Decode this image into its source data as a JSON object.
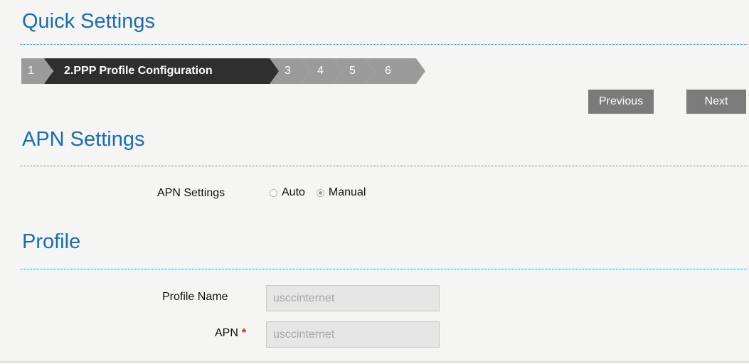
{
  "page": {
    "title": "Quick Settings"
  },
  "wizard": {
    "steps": [
      {
        "label": "1",
        "active": false
      },
      {
        "label": "2.PPP Profile Configuration",
        "active": true
      },
      {
        "label": "3",
        "active": false
      },
      {
        "label": "4",
        "active": false
      },
      {
        "label": "5",
        "active": false
      },
      {
        "label": "6",
        "active": false
      }
    ],
    "previous_label": "Previous",
    "next_label": "Next"
  },
  "apn_section": {
    "title": "APN Settings",
    "field_label": "APN Settings",
    "options": [
      {
        "label": "Auto",
        "checked": false
      },
      {
        "label": "Manual",
        "checked": true
      }
    ]
  },
  "profile_section": {
    "title": "Profile",
    "profile_name": {
      "label": "Profile Name",
      "value": "usccinternet"
    },
    "apn": {
      "label": "APN",
      "required_mark": "*",
      "value": "usccinternet"
    }
  },
  "colors": {
    "heading": "#1a6cb3",
    "step_active": "#2f2f2f",
    "step_inactive": "#9b9b9b",
    "button": "#7b7b7b",
    "required": "#cc1f1f"
  }
}
